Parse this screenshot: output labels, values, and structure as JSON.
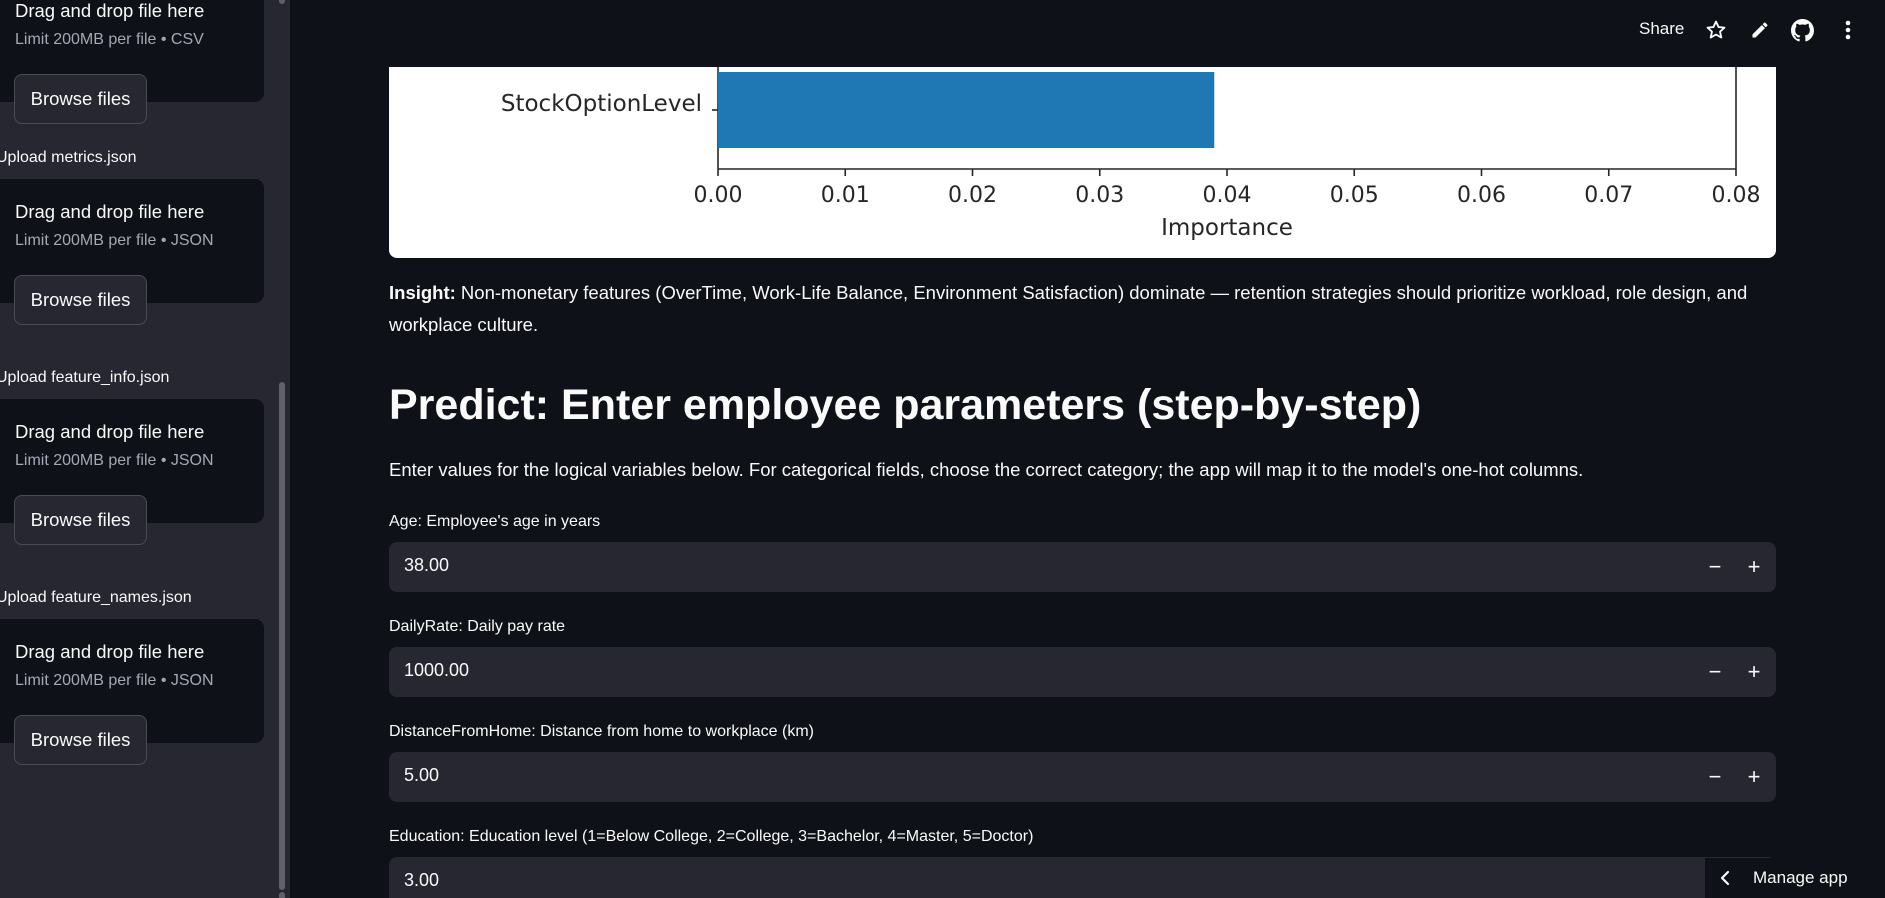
{
  "sidebar": {
    "uploads": [
      {
        "label": "",
        "dropzone_title": "Drag and drop file here",
        "limit": "Limit 200MB per file • CSV",
        "button": "Browse files"
      },
      {
        "label": "Upload metrics.json",
        "dropzone_title": "Drag and drop file here",
        "limit": "Limit 200MB per file • JSON",
        "button": "Browse files"
      },
      {
        "label": "Upload feature_info.json",
        "dropzone_title": "Drag and drop file here",
        "limit": "Limit 200MB per file • JSON",
        "button": "Browse files"
      },
      {
        "label": "Upload feature_names.json",
        "dropzone_title": "Drag and drop file here",
        "limit": "Limit 200MB per file • JSON",
        "button": "Browse files"
      }
    ]
  },
  "header": {
    "share_label": "Share",
    "icons": [
      "star-icon",
      "pencil-icon",
      "github-icon",
      "more-vertical-icon"
    ]
  },
  "chart_data": {
    "type": "bar",
    "orientation": "horizontal",
    "categories": [
      "StockOptionLevel"
    ],
    "values": [
      0.039
    ],
    "xlabel": "Importance",
    "xlim": [
      0.0,
      0.08
    ],
    "xticks": [
      "0.00",
      "0.01",
      "0.02",
      "0.03",
      "0.04",
      "0.05",
      "0.06",
      "0.07",
      "0.08"
    ],
    "bar_color": "#1f77b4"
  },
  "insight": {
    "prefix": "Insight:",
    "text": " Non-monetary features (OverTime, Work-Life Balance, Environment Satisfaction) dominate — retention strategies should prioritize workload, role design, and workplace culture."
  },
  "predict": {
    "heading": "Predict: Enter employee parameters (step-by-step)",
    "description": "Enter values for the logical variables below. For categorical fields, choose the correct category; the app will map it to the model's one-hot columns."
  },
  "inputs": [
    {
      "label": "Age: Employee's age in years",
      "value": "38.00"
    },
    {
      "label": "DailyRate: Daily pay rate",
      "value": "1000.00"
    },
    {
      "label": "DistanceFromHome: Distance from home to workplace (km)",
      "value": "5.00"
    },
    {
      "label": "Education: Education level (1=Below College, 2=College, 3=Bachelor, 4=Master, 5=Doctor)",
      "value": "3.00"
    }
  ],
  "stepper": {
    "minus": "−",
    "plus": "+"
  },
  "manage_app": {
    "label": "Manage app"
  },
  "colors": {
    "background": "#0e1117",
    "sidebar": "#262730",
    "input_bg": "#262730",
    "bar": "#1f77b4"
  }
}
